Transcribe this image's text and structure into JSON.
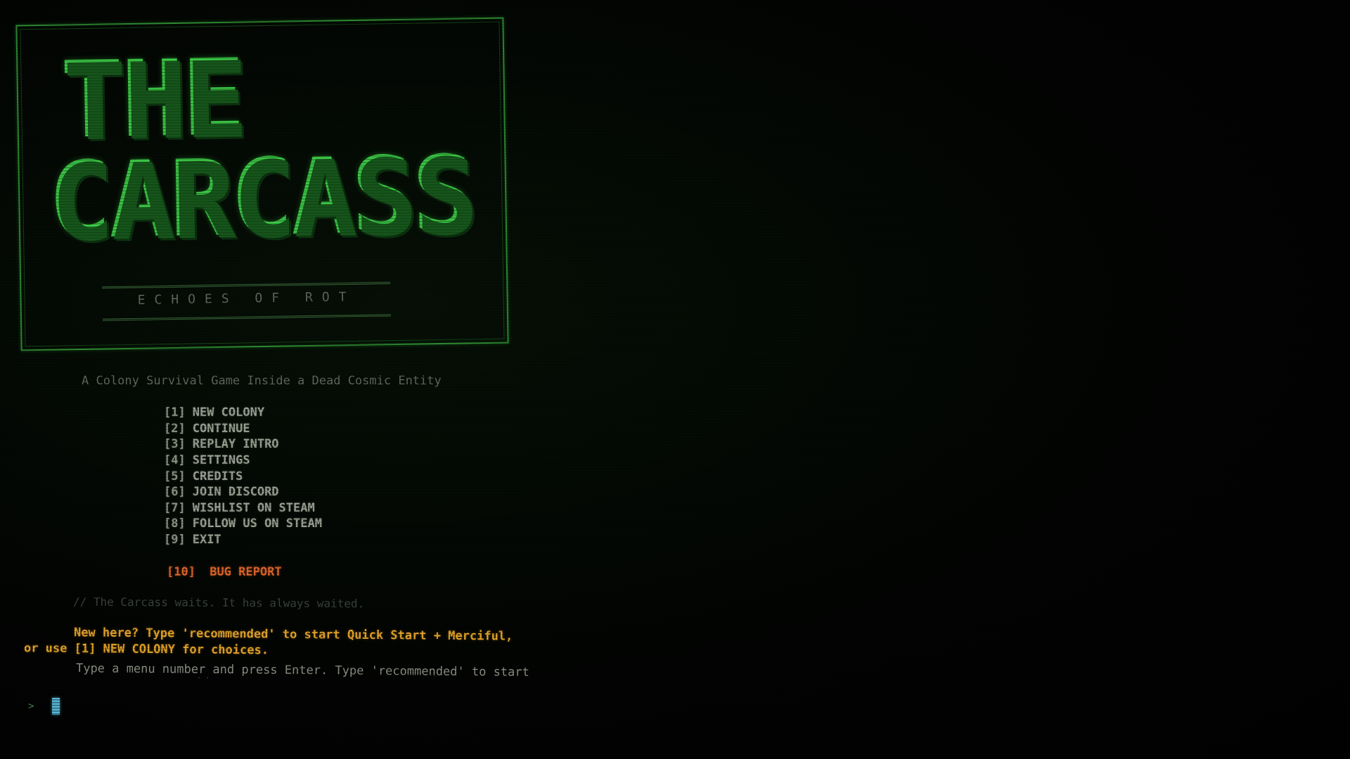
{
  "title": {
    "line1": "THE",
    "line2": "CARCASS",
    "tagline": "ECHOES OF ROT"
  },
  "subtitle": "A Colony Survival Game Inside a Dead Cosmic Entity",
  "menu": {
    "items": [
      {
        "key": "[1]",
        "label": "NEW COLONY"
      },
      {
        "key": "[2]",
        "label": "CONTINUE"
      },
      {
        "key": "[3]",
        "label": "REPLAY INTRO"
      },
      {
        "key": "[4]",
        "label": "SETTINGS"
      },
      {
        "key": "[5]",
        "label": "CREDITS"
      },
      {
        "key": "[6]",
        "label": "JOIN DISCORD"
      },
      {
        "key": "[7]",
        "label": "WISHLIST ON STEAM"
      },
      {
        "key": "[8]",
        "label": "FOLLOW US ON STEAM"
      },
      {
        "key": "[9]",
        "label": "EXIT"
      }
    ],
    "bug_report": {
      "key": "[10]",
      "label": "BUG REPORT"
    }
  },
  "comment": "// The Carcass waits. It has always waited.",
  "hint": {
    "line1": "New here? Type 'recommended' to start Quick Start + Merciful,",
    "line2": "or use [1] NEW COLONY for choices."
  },
  "instructions": "Type a menu number and press Enter. Type 'recommended' to start",
  "instructions_tail": "' '",
  "prompt": {
    "symbol": ">",
    "value": "",
    "placeholder": ""
  },
  "colors": {
    "logo_green": "#39b443",
    "frame_green": "#2e8a32",
    "menu_text": "#9da395",
    "bug_report_orange": "#e0662b",
    "hint_amber": "#e8a62a",
    "cursor_cyan": "#5fc0e0",
    "background": "#020302"
  },
  "icons": {
    "prompt": "prompt-chevron-icon",
    "cursor": "block-cursor-icon"
  }
}
